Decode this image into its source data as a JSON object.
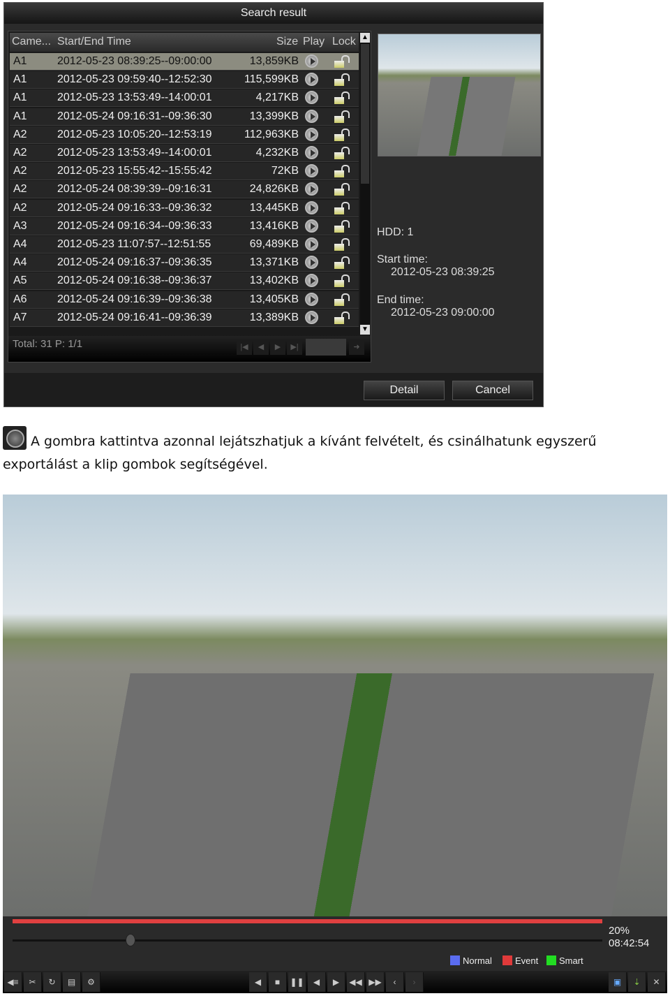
{
  "dialog": {
    "title": "Search result",
    "columns": [
      "Came...",
      "Start/End Time",
      "Size",
      "Play",
      "Lock"
    ],
    "rows": [
      {
        "camera": "A1",
        "time": "2012-05-23 08:39:25--09:00:00",
        "size": "13,859KB",
        "selected": true
      },
      {
        "camera": "A1",
        "time": "2012-05-23 09:59:40--12:52:30",
        "size": "115,599KB"
      },
      {
        "camera": "A1",
        "time": "2012-05-23 13:53:49--14:00:01",
        "size": "4,217KB"
      },
      {
        "camera": "A1",
        "time": "2012-05-24 09:16:31--09:36:30",
        "size": "13,399KB"
      },
      {
        "camera": "A2",
        "time": "2012-05-23 10:05:20--12:53:19",
        "size": "112,963KB"
      },
      {
        "camera": "A2",
        "time": "2012-05-23 13:53:49--14:00:01",
        "size": "4,232KB"
      },
      {
        "camera": "A2",
        "time": "2012-05-23 15:55:42--15:55:42",
        "size": "72KB"
      },
      {
        "camera": "A2",
        "time": "2012-05-24 08:39:39--09:16:31",
        "size": "24,826KB"
      },
      {
        "camera": "A2",
        "time": "2012-05-24 09:16:33--09:36:32",
        "size": "13,445KB"
      },
      {
        "camera": "A3",
        "time": "2012-05-24 09:16:34--09:36:33",
        "size": "13,416KB"
      },
      {
        "camera": "A4",
        "time": "2012-05-23 11:07:57--12:51:55",
        "size": "69,489KB"
      },
      {
        "camera": "A4",
        "time": "2012-05-24 09:16:37--09:36:35",
        "size": "13,371KB"
      },
      {
        "camera": "A5",
        "time": "2012-05-24 09:16:38--09:36:37",
        "size": "13,402KB"
      },
      {
        "camera": "A6",
        "time": "2012-05-24 09:16:39--09:36:38",
        "size": "13,405KB"
      },
      {
        "camera": "A7",
        "time": "2012-05-24 09:16:41--09:36:39",
        "size": "13,389KB"
      }
    ],
    "footer": {
      "total": "Total: 31  P: 1/1"
    },
    "info": {
      "hdd": "HDD: 1",
      "start_label": "Start time:",
      "start_value": "2012-05-23 08:39:25",
      "end_label": "End time:",
      "end_value": "2012-05-23 09:00:00"
    },
    "buttons": {
      "detail": "Detail",
      "cancel": "Cancel"
    }
  },
  "caption": "A gombra kattintva azonnal lejátszhatjuk a kívánt felvételt, és csinálhatunk egyszerű exportálást a klip gombok segítségével.",
  "player": {
    "progress_percent": "20%",
    "progress": 0.2,
    "time": "08:42:54",
    "legend": [
      {
        "label": "Normal",
        "color": "#5a6cf0"
      },
      {
        "label": "Event",
        "color": "#e03a3a"
      },
      {
        "label": "Smart",
        "color": "#22dd22"
      }
    ]
  }
}
